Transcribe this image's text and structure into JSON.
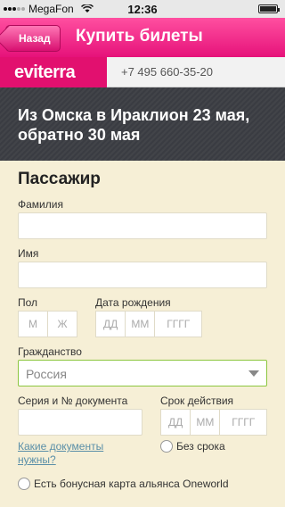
{
  "status": {
    "carrier": "MegaFon",
    "time": "12:36"
  },
  "nav": {
    "back_label": "Назад",
    "title": "Купить билеты"
  },
  "brand": {
    "logo_text": "eviterra",
    "phone": "+7 495 660-35-20"
  },
  "route": {
    "heading": "Из Омска в Ираклион 23 мая, обратно 30 мая"
  },
  "form": {
    "section_title": "Пассажир",
    "surname_label": "Фамилия",
    "name_label": "Имя",
    "gender_label": "Пол",
    "gender_options": [
      "М",
      "Ж"
    ],
    "birthdate_label": "Дата рождения",
    "birthdate_placeholders": [
      "ДД",
      "ММ",
      "ГГГГ"
    ],
    "citizenship_label": "Гражданство",
    "citizenship_value": "Россия",
    "document_label": "Серия и № документа",
    "expiry_label": "Срок действия",
    "expiry_placeholders": [
      "ДД",
      "ММ",
      "ГГГГ"
    ],
    "docs_link": "Какие документы нужны?",
    "no_expiry_label": "Без срока",
    "bonus_card_label": "Есть бонусная карта альянса Oneworld"
  },
  "colors": {
    "accent": "#e2106f",
    "valid": "#8cc63f",
    "background": "#f6efd6"
  }
}
